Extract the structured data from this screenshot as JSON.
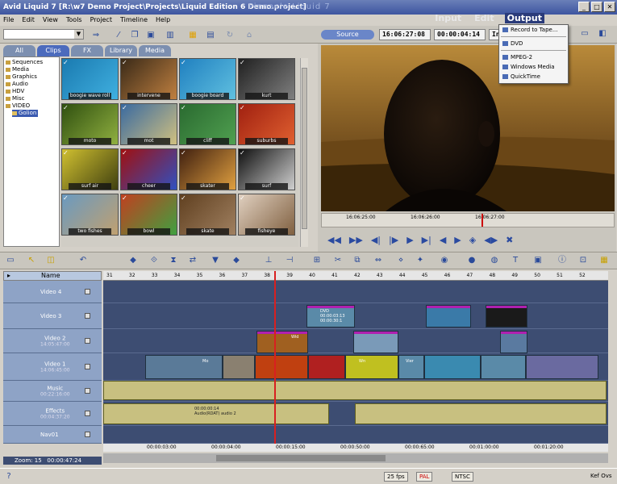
{
  "window": {
    "title": "Avid Liquid 7 [R:\\w7 Demo Project\\Projects\\Liquid Edition 6 Demo.project]",
    "brand": "Pinnacle Liquid 7",
    "buttons": [
      "_",
      "□",
      "✕"
    ]
  },
  "menu": [
    "File",
    "Edit",
    "View",
    "Tools",
    "Project",
    "Timeline",
    "Help"
  ],
  "modes": [
    {
      "label": "Input",
      "active": false
    },
    {
      "label": "Edit",
      "active": false
    },
    {
      "label": "Output",
      "active": true
    }
  ],
  "output_menu": {
    "items": [
      "Record to Tape...",
      "DVD",
      "MPEG-2",
      "Windows Media",
      "QuickTime"
    ]
  },
  "viewer": {
    "source_label": "Source",
    "timecode_in": "16:06:27:08",
    "timecode_dur": "00:00:04:14",
    "zoom_label": "Inter",
    "ruler_ticks": [
      "16:06:25:00",
      "16:06:26:00",
      "16:06:27:00"
    ]
  },
  "bins": {
    "tabs": [
      "All",
      "Clips",
      "FX",
      "Library",
      "Media"
    ],
    "active_tab": "Clips",
    "tree": [
      "Sequences",
      "Media",
      "Graphics",
      "Audio",
      "HDV",
      "Misc",
      "VIDEO",
      "Golion"
    ],
    "clips": [
      {
        "label": "boogie wave roll"
      },
      {
        "label": "intervene"
      },
      {
        "label": "boogie board"
      },
      {
        "label": "kurt"
      },
      {
        "label": "moto"
      },
      {
        "label": "mot"
      },
      {
        "label": "cliff"
      },
      {
        "label": "suburbs"
      },
      {
        "label": "surf air"
      },
      {
        "label": "cheer"
      },
      {
        "label": "skater"
      },
      {
        "label": "surf"
      },
      {
        "label": "two fishes"
      },
      {
        "label": "bowl"
      },
      {
        "label": "skate"
      },
      {
        "label": "fisheye"
      }
    ]
  },
  "timeline": {
    "header_name": "Name",
    "ruler": [
      "31",
      "32",
      "33",
      "34",
      "35",
      "36",
      "37",
      "38",
      "39",
      "40",
      "41",
      "42",
      "43",
      "44",
      "45",
      "46",
      "47",
      "48",
      "49",
      "50",
      "51",
      "52"
    ],
    "tracks": [
      {
        "name": "Video 4",
        "time": ""
      },
      {
        "name": "Video 3",
        "time": ""
      },
      {
        "name": "Video 2",
        "time": "14:05:47:00"
      },
      {
        "name": "Video 1",
        "time": "14:06:45:00"
      },
      {
        "name": "Music",
        "time": "00:22:16:00"
      },
      {
        "name": "Effects",
        "time": "00:04:37:20"
      },
      {
        "name": "Nav01",
        "time": ""
      }
    ],
    "clip_labels": {
      "dvd_clip": "DVD",
      "dvd_tc": "00:00:03:13",
      "dvd_tc2": "00:00:30:1",
      "video2_a": "Wid",
      "video1_a": "Mo",
      "video1_b": "Wn",
      "video1_c": "Vier",
      "audio_tc": "00:00:00:14",
      "audio_name": "Audio(RDAT) audio 2"
    },
    "bottom_ruler": [
      "00:00:03:00",
      "00:00:04:00",
      "00:00:15:00",
      "00:00:50:00",
      "00:00:65:00",
      "00:01:00:00",
      "00:01:20:00"
    ],
    "zoom_label": "Zoom: 15",
    "zoom_time": "00:00:47:24"
  },
  "status": {
    "fps": "25 fps",
    "mode": "PAL",
    "info": "NTSC",
    "tail": "Kef Ovs"
  }
}
